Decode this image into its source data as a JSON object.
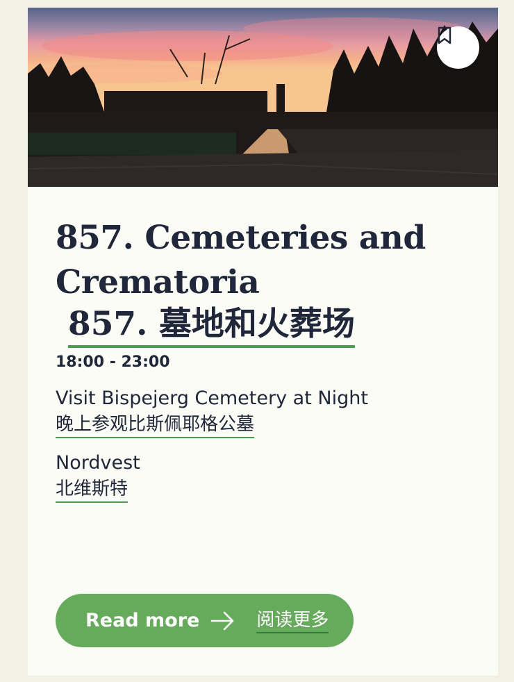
{
  "card": {
    "bookmark_icon": "bookmark-icon",
    "title": "857. Cemeteries and Crematoria",
    "title_zh": "857. 墓地和火葬场",
    "time": "18:00 - 23:00",
    "description": "Visit Bispejerg Cemetery at Night",
    "description_zh": "晚上参观比斯佩耶格公墓",
    "location": "Nordvest",
    "location_zh": "北维斯特",
    "read_more_label": "Read more",
    "read_more_icon": "arrow-right-icon",
    "read_more_zh": "阅读更多"
  },
  "colors": {
    "background": "#f3f1e6",
    "card": "#fcfcf7",
    "text": "#20273a",
    "accent_green": "#66aa5c",
    "underline_green": "#4e9b57"
  }
}
